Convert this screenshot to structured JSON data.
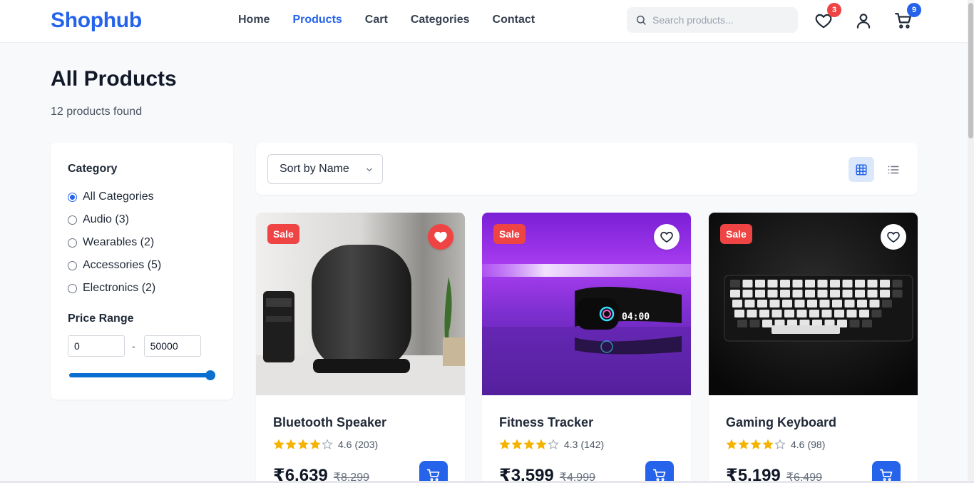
{
  "header": {
    "logo": "Shophub",
    "nav": [
      "Home",
      "Products",
      "Cart",
      "Categories",
      "Contact"
    ],
    "search_placeholder": "Search products...",
    "wishlist_count": "3",
    "cart_count": "9",
    "badge_colors": {
      "wishlist": "#ef4444",
      "cart": "#2563eb"
    },
    "icons": [
      "search-icon",
      "heart-icon",
      "user-icon",
      "cart-icon"
    ]
  },
  "page": {
    "title": "All Products",
    "result_count": "12 products found"
  },
  "sidebar": {
    "category_heading": "Category",
    "categories": [
      {
        "label": "All Categories",
        "checked": true
      },
      {
        "label": "Audio (3)",
        "checked": false
      },
      {
        "label": "Wearables (2)",
        "checked": false
      },
      {
        "label": "Accessories (5)",
        "checked": false
      },
      {
        "label": "Electronics (2)",
        "checked": false
      }
    ],
    "price_heading": "Price Range",
    "price_min": "0",
    "price_max": "50000",
    "price_separator": "-",
    "slider_level": 1.0
  },
  "toolbar": {
    "sort_label": "Sort by Name",
    "view_mode": "grid",
    "icons": [
      "grid-view-icon",
      "list-view-icon"
    ]
  },
  "products": [
    {
      "name": "Bluetooth Speaker",
      "badge": "Sale",
      "rating": "4.6",
      "reviews": "(203)",
      "stars": 4.6,
      "price": "₹6,639",
      "old_price": "₹8,299",
      "wishlisted": true
    },
    {
      "name": "Fitness Tracker",
      "badge": "Sale",
      "rating": "4.3",
      "reviews": "(142)",
      "stars": 4.3,
      "price": "₹3,599",
      "old_price": "₹4,999",
      "wishlisted": false
    },
    {
      "name": "Gaming Keyboard",
      "badge": "Sale",
      "rating": "4.6",
      "reviews": "(98)",
      "stars": 4.6,
      "price": "₹5,199",
      "old_price": "₹6,499",
      "wishlisted": false
    }
  ],
  "colors": {
    "accent": "#2563eb",
    "sale": "#ef4444",
    "star": "#f5b301"
  }
}
